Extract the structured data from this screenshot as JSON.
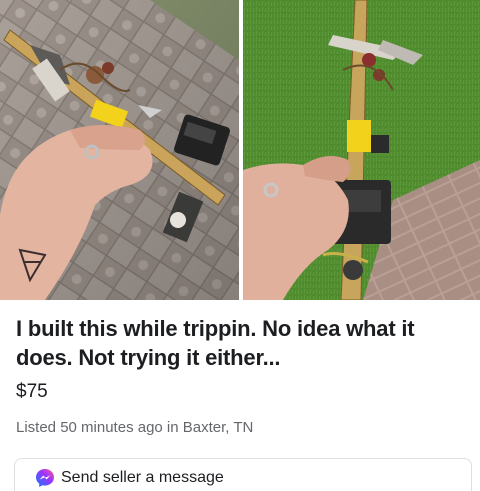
{
  "listing": {
    "title": "I built this while trippin. No idea what it does. Not trying it either...",
    "price": "$75",
    "meta": "Listed 50 minutes ago in Baxter, TN"
  },
  "actions": {
    "message_label": "Send seller a message"
  },
  "icons": {
    "message": "messenger-icon"
  },
  "colors": {
    "text_primary": "#1c1e21",
    "text_secondary": "#65676b",
    "messenger_blue": "#0a7cff",
    "messenger_purple": "#a033ff",
    "border": "#dddfe2"
  }
}
